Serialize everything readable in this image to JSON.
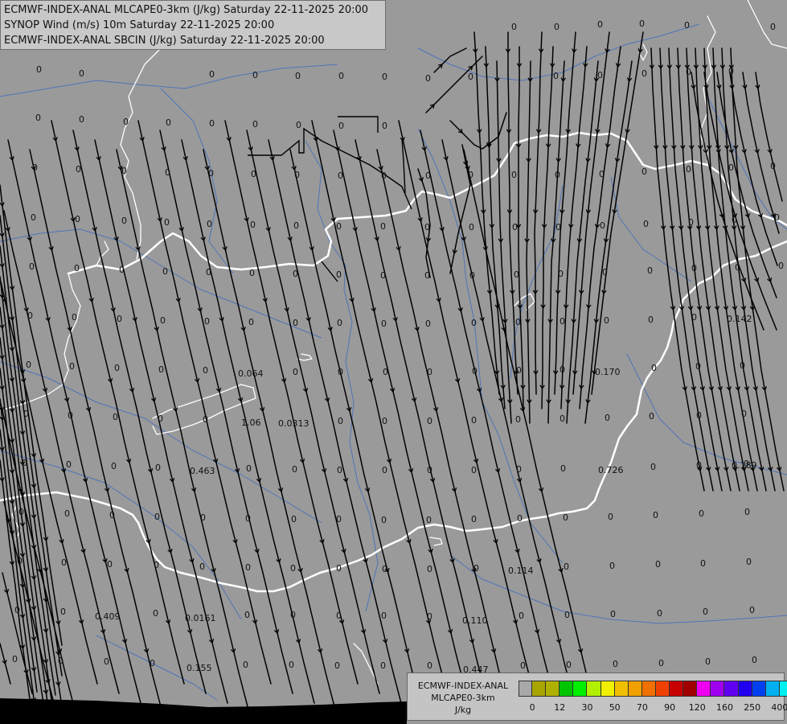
{
  "title_lines": [
    "ECMWF-INDEX-ANAL MLCAPE0-3km (J/kg) Saturday 22-11-2025 20:00",
    "SYNOP Wind (m/s) 10m Saturday 22-11-2025 20:00",
    "ECMWF-INDEX-ANAL SBCIN (J/kg) Saturday 22-11-2025 20:00"
  ],
  "legend": {
    "lines": [
      "ECMWF-INDEX-ANAL",
      "MLCAPE0-3km",
      "J/kg"
    ],
    "colors": [
      "#a8a8a8",
      "#a8a400",
      "#b0b000",
      "#00c400",
      "#00f000",
      "#b0f000",
      "#f0f000",
      "#f0c000",
      "#f0a000",
      "#f07000",
      "#f04000",
      "#c80000",
      "#a00000",
      "#f000f0",
      "#a000f0",
      "#6000f0",
      "#2000f0",
      "#0040f0",
      "#00b0f0",
      "#00f0f0",
      "#c0ffff",
      "#ffffff"
    ],
    "ticks": [
      {
        "label": "0",
        "index": 1
      },
      {
        "label": "12",
        "index": 3
      },
      {
        "label": "30",
        "index": 5
      },
      {
        "label": "50",
        "index": 7
      },
      {
        "label": "70",
        "index": 9
      },
      {
        "label": "90",
        "index": 11
      },
      {
        "label": "120",
        "index": 13
      },
      {
        "label": "160",
        "index": 15
      },
      {
        "label": "250",
        "index": 17
      },
      {
        "label": "400",
        "index": 19
      }
    ]
  },
  "map_colors": {
    "background": "#9a9a9a",
    "border": "#ffffff",
    "rivers": "#4f74b8",
    "streamlines": "#000000",
    "value_text": "#111111",
    "sea": "#000000"
  },
  "zero_label": "0",
  "nonzero_values": [
    "0.142",
    "0.170",
    "0.064",
    "1.06",
    "0.0313",
    "0.463",
    "0.726",
    "0.189",
    "0.114",
    "0.409",
    "0.0161",
    "0.110",
    "0.155",
    "0.447"
  ]
}
